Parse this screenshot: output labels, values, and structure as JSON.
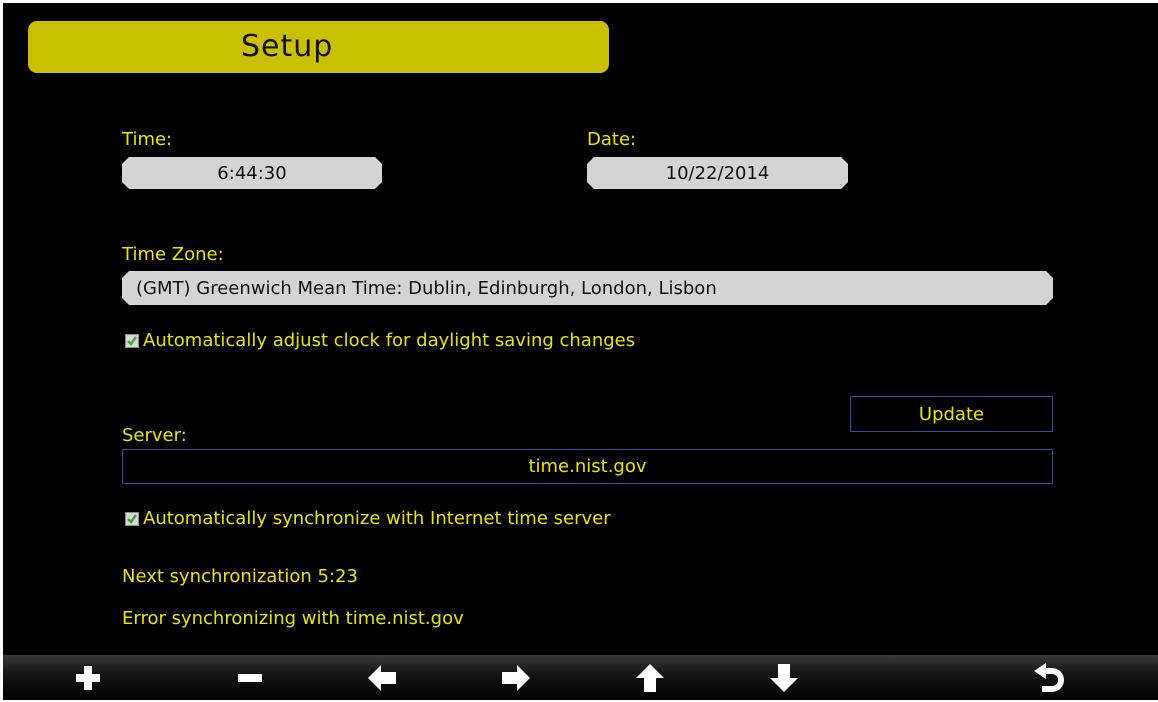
{
  "header": {
    "title": "Setup"
  },
  "time": {
    "label": "Time:",
    "value": "6:44:30"
  },
  "date": {
    "label": "Date:",
    "value": "10/22/2014"
  },
  "timezone": {
    "label": "Time Zone:",
    "value": "(GMT) Greenwich Mean Time: Dublin, Edinburgh, London, Lisbon"
  },
  "dst_checkbox": {
    "checked": true,
    "label": "Automatically adjust clock for daylight saving changes"
  },
  "server": {
    "label": "Server:",
    "value": "time.nist.gov",
    "update_label": "Update"
  },
  "sync_checkbox": {
    "checked": true,
    "label": "Automatically synchronize with Internet time server"
  },
  "status": {
    "next_sync": "Next synchronization  5:23",
    "error": "Error synchronizing with time.nist.gov"
  },
  "toolbar": {
    "buttons": [
      "plus-icon",
      "minus-icon",
      "arrow-left-icon",
      "arrow-right-icon",
      "arrow-up-icon",
      "arrow-down-icon",
      "return-icon"
    ]
  },
  "colors": {
    "background": "#000000",
    "title_bar": "#c8c000",
    "text": "#e8e600",
    "field": "#d4d4d4",
    "outline": "#2a54a0",
    "check": "#3fa83a"
  }
}
